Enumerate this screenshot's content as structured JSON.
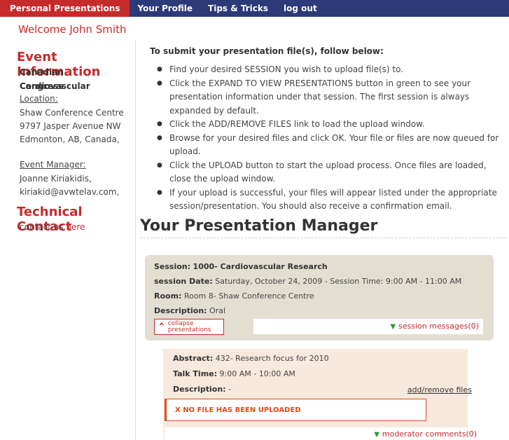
{
  "nav": {
    "tabs": [
      "Personal Presentations",
      "Your Profile",
      "Tips & Tricks",
      "log out"
    ],
    "active_tab": "Personal Presentations"
  },
  "welcome": "Welcome John Smith",
  "sidebar": {
    "event_heading": "Event Information",
    "event_name_1": "Canadian Cardiovascular",
    "event_name_2": "Congress",
    "location_label": "Location:",
    "location_1": "Shaw Conference Centre",
    "location_2": "9797 Jasper Avenue NW",
    "location_3": "Edmonton, AB, Canada,",
    "manager_label": "Event Manager:",
    "manager_name": "Joanne Kiriakidis,",
    "manager_email": "kiriakid@avwtelav.com,",
    "tech_heading": "Technical Contact",
    "contact_prefix": "contact us",
    "contact_link": "here"
  },
  "instructions": {
    "title": "To submit your presentation file(s), follow below:",
    "items": [
      "Find your desired SESSION you wish to upload file(s) to.",
      "Click the EXPAND TO VIEW PRESENTATIONS button in green to see your presentation information under that session. The first session is always expanded by default.",
      "Click the ADD/REMOVE FILES link to load the upload window.",
      "Browse for your desired files and click OK. Your file or files are now queued for upload.",
      "Click the UPLOAD button to start the upload process. Once files are loaded, close the upload window.",
      "If your upload is successful, your files will appear listed under the appropriate session/presentation. You should also receive a confirmation email."
    ]
  },
  "manager_title": "Your Presentation Manager",
  "session": {
    "session_label": "Session:",
    "session_value": "1000- Cardiovascular Research",
    "date_label": "session Date:",
    "date_value": "Saturday, October 24, 2009 - Session Time: 9:00 AM - 11:00 AM",
    "room_label": "Room:",
    "room_value": "Room 8- Shaw Conference Centre",
    "desc_label": "Description:",
    "desc_value": "Oral",
    "collapse_label_1": "collapse",
    "collapse_label_2": "presentations",
    "messages_link": "session messages(0)"
  },
  "abstract": {
    "abstract_label": "Abstract:",
    "abstract_value": "432- Research focus for 2010",
    "talk_label": "Talk Time:",
    "talk_value": "9:00 AM - 10:00 AM",
    "desc_label": "Description:",
    "desc_value": "-",
    "add_remove": "add/remove files",
    "no_file": "X NO FILE HAS BEEN UPLOADED",
    "moderator_link": "moderator comments(0)"
  },
  "colors": {
    "nav_bg": "#2d3a78",
    "accent_red": "#c62b2b",
    "session_bg": "#e3ded2",
    "abstract_bg": "#f7e9dd",
    "error": "#e04a1a",
    "green_arrow": "#2e9b2e"
  },
  "icons": [
    "chevron-up-icon",
    "green-down-arrow-icon"
  ]
}
